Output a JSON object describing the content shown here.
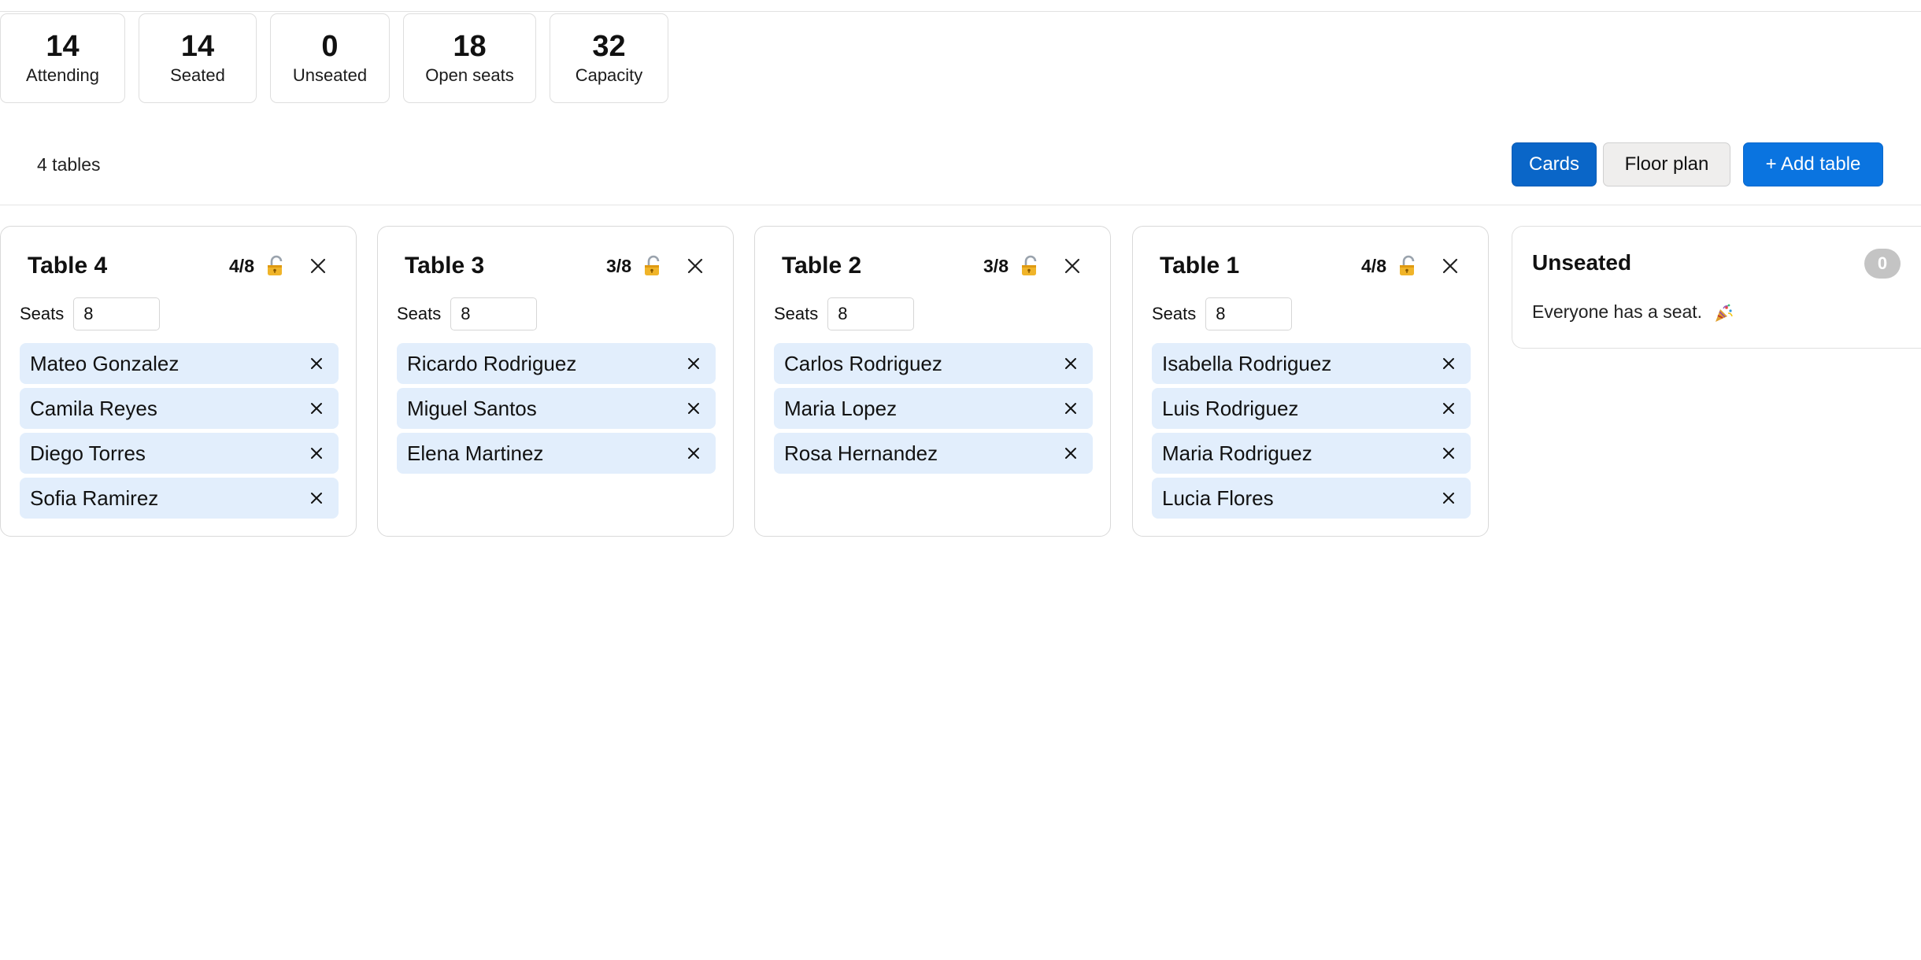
{
  "stats": [
    {
      "value": "14",
      "label": "Attending"
    },
    {
      "value": "14",
      "label": "Seated"
    },
    {
      "value": "0",
      "label": "Unseated"
    },
    {
      "value": "18",
      "label": "Open seats"
    },
    {
      "value": "32",
      "label": "Capacity"
    }
  ],
  "toolbar": {
    "table_count": "4 tables",
    "cards_label": "Cards",
    "floor_plan_label": "Floor plan",
    "add_table_label": "+ Add table"
  },
  "seats_label": "Seats",
  "tables": [
    {
      "name": "Table 4",
      "count": "4/8",
      "seats": "8",
      "guests": [
        "Mateo Gonzalez",
        "Camila Reyes",
        "Diego Torres",
        "Sofia Ramirez"
      ]
    },
    {
      "name": "Table 3",
      "count": "3/8",
      "seats": "8",
      "guests": [
        "Ricardo Rodriguez",
        "Miguel Santos",
        "Elena Martinez"
      ]
    },
    {
      "name": "Table 2",
      "count": "3/8",
      "seats": "8",
      "guests": [
        "Carlos Rodriguez",
        "Maria Lopez",
        "Rosa Hernandez"
      ]
    },
    {
      "name": "Table 1",
      "count": "4/8",
      "seats": "8",
      "guests": [
        "Isabella Rodriguez",
        "Luis Rodriguez",
        "Maria Rodriguez",
        "Lucia Flores"
      ]
    }
  ],
  "unseated": {
    "title": "Unseated",
    "count": "0",
    "message": "Everyone has a seat."
  },
  "icons": {
    "lock": "unlocked-padlock-icon",
    "close": "close-icon",
    "remove": "remove-x-icon",
    "party": "party-popper-icon"
  },
  "colors": {
    "primary": "#0a66c8",
    "add_button": "#0a74e0",
    "guest_chip": "#e2eefc",
    "badge": "#c4c4c4"
  }
}
